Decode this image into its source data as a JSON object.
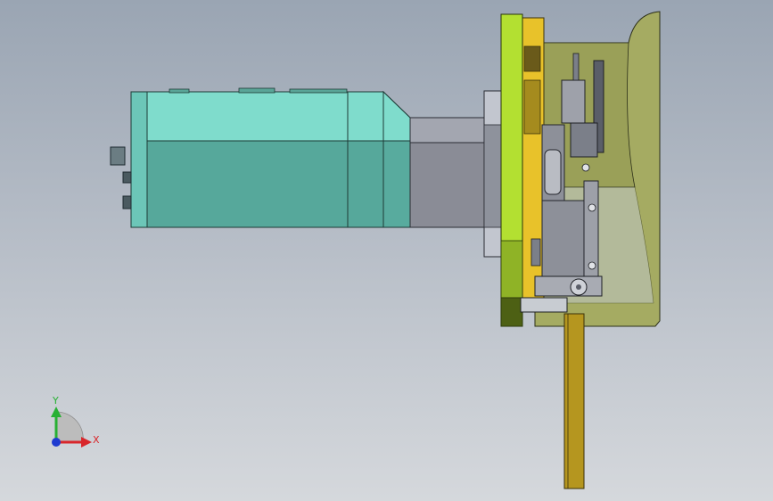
{
  "viewport": {
    "background_top": "#9aa5b3",
    "background_bottom": "#d5d8dc"
  },
  "model": {
    "motor_color_light": "#7fdccc",
    "motor_color_dark": "#56a89b",
    "gearbox_color": "#8a8c96",
    "flange_color": "#b3e031",
    "plate_color": "#e8c22a",
    "bracket_color": "#a5ab62",
    "rail_color": "#b5961f",
    "block_color": "#8d9099"
  },
  "triad": {
    "x_label": "X",
    "y_label": "Y",
    "x_color": "#d8262b",
    "y_color": "#27b033",
    "z_color": "#1f3bd0"
  }
}
